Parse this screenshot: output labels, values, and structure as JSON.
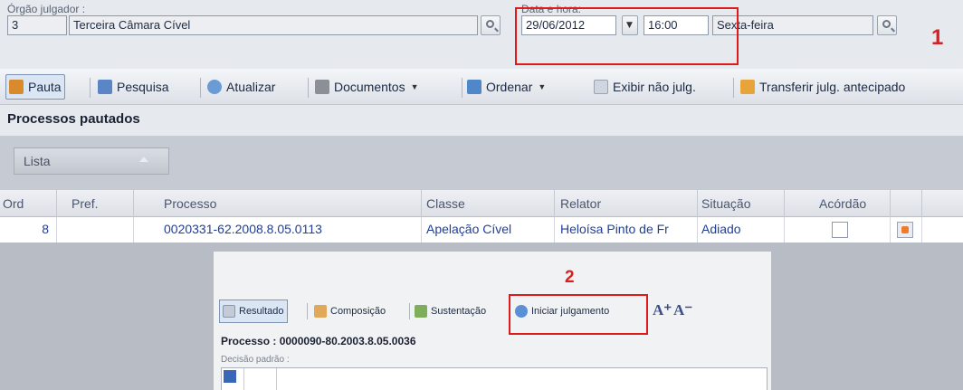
{
  "orgao": {
    "label": "Órgão julgador :",
    "code": "3",
    "name": "Terceira Câmara Cível"
  },
  "datahora": {
    "label": "Data e hora:",
    "date": "29/06/2012",
    "time": "16:00",
    "weekday": "Sexta-feira"
  },
  "annotations": {
    "one": "1",
    "two": "2",
    "highlight_color": "#e01a1a"
  },
  "toolbar": {
    "pauta": "Pauta",
    "pesquisa": "Pesquisa",
    "atualizar": "Atualizar",
    "documentos": "Documentos",
    "ordenar": "Ordenar",
    "exibir": "Exibir não julg.",
    "transferir": "Transferir julg. antecipado"
  },
  "section_title": "Processos pautados",
  "grouping": {
    "label": "Lista"
  },
  "table": {
    "columns": [
      "Ord",
      "Pref.",
      "Processo",
      "Classe",
      "Relator",
      "Situação",
      "Acórdão"
    ],
    "rows": [
      {
        "ord": "8",
        "pref": "",
        "processo": "0020331-62.2008.8.05.0113",
        "classe": "Apelação Cível",
        "relator": "Heloísa Pinto de Fr",
        "situacao": "Adiado",
        "acordao": false
      }
    ]
  },
  "panel": {
    "toolbar": {
      "resultado": "Resultado",
      "composicao": "Composição",
      "sustentacao": "Sustentação",
      "iniciar": "Iniciar julgamento",
      "font_up": "A⁺",
      "font_down": "A⁻"
    },
    "processo_label": "Processo : 0000090-80.2003.8.05.0036",
    "decisao_label": "Decisão padrão :"
  },
  "colors": {
    "accent": "#1f3f99",
    "link": "#1f3f99",
    "status_orange": "#f07a2a"
  }
}
